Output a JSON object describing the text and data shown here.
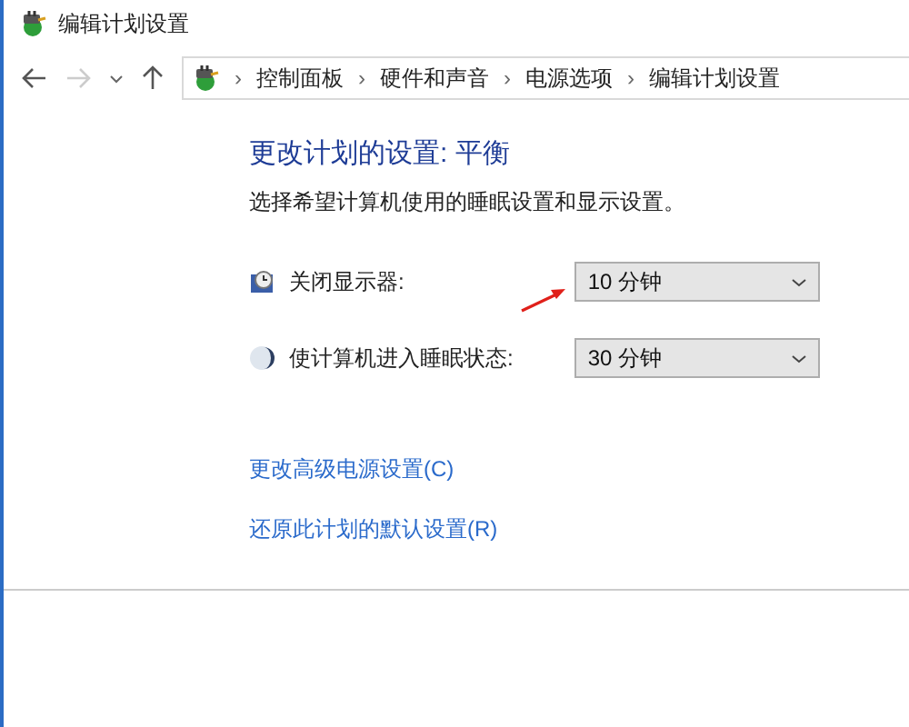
{
  "window": {
    "title": "编辑计划设置"
  },
  "nav": {
    "forward_enabled": false,
    "separator": "›",
    "breadcrumbs": [
      "控制面板",
      "硬件和声音",
      "电源选项",
      "编辑计划设置"
    ]
  },
  "settings": {
    "heading": "更改计划的设置: 平衡",
    "description": "选择希望计算机使用的睡眠设置和显示设置。",
    "rows": [
      {
        "kind": "display",
        "label": "关闭显示器:",
        "value": "10 分钟",
        "annotated": true
      },
      {
        "kind": "sleep",
        "label": "使计算机进入睡眠状态:",
        "value": "30 分钟",
        "annotated": false
      }
    ],
    "links": [
      "更改高级电源设置(C)",
      "还原此计划的默认设置(R)"
    ]
  }
}
